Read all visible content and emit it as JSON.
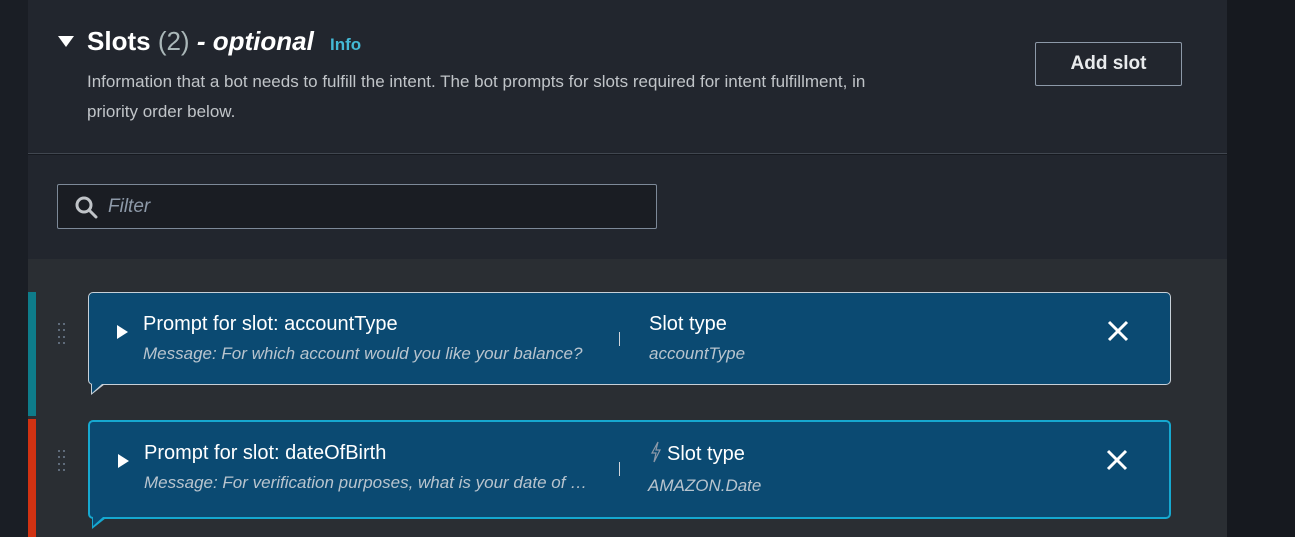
{
  "header": {
    "title": "Slots",
    "count": "(2)",
    "optional": "- optional",
    "info_link": "Info",
    "description": "Information that a bot needs to fulfill the intent. The bot prompts for slots required for intent fulfillment, in priority order below.",
    "add_slot_label": "Add slot"
  },
  "filter": {
    "placeholder": "Filter",
    "value": ""
  },
  "slots": [
    {
      "title": "Prompt for slot: accountType",
      "message": "Message: For which account would you like your balance?",
      "slot_type_label": "Slot type",
      "slot_type_value": "accountType",
      "bar_color": "#0e7c8a"
    },
    {
      "title": "Prompt for slot: dateOfBirth",
      "message": "Message: For verification purposes, what is your date of birth?",
      "slot_type_label": "Slot type",
      "slot_type_value": "AMAZON.Date",
      "bar_color": "#d13212"
    }
  ],
  "colors": {
    "accent_link": "#44b9d6",
    "card_bg": "#0b4a72",
    "selected_border": "#16a8d0"
  },
  "icons": [
    "search-icon",
    "caret-down-icon",
    "play-icon",
    "close-icon",
    "bolt-icon",
    "drag-handle-icon"
  ]
}
